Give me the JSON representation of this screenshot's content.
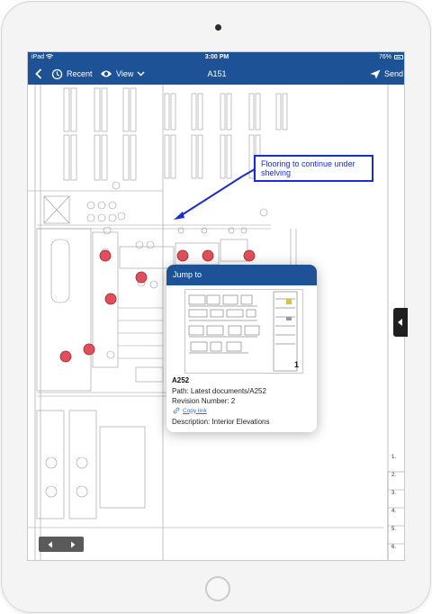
{
  "status": {
    "carrier": "iPad",
    "time": "3:00 PM",
    "battery": "76%"
  },
  "nav": {
    "back_icon": "chevron-left-icon",
    "recent_label": "Recent",
    "view_label": "View",
    "title": "A151",
    "send_label": "Send"
  },
  "callout": {
    "text": "Flooring to continue under shelving"
  },
  "jump_popup": {
    "header": "Jump to",
    "thumbnail_page_number": "1",
    "name": "A252",
    "path": "Path:  Latest documents/A252",
    "revision": "Revision Number: 2",
    "copy_link": "Copy link",
    "description": "Description: Interior Elevations"
  },
  "schedule_numbers": [
    "1.",
    "2.",
    "3.",
    "4.",
    "5.",
    "6."
  ],
  "colors": {
    "brand_blue": "#1d5396",
    "markup_blue": "#1b2bd6",
    "marker_red": "#e0505a",
    "link": "#2a6fd1"
  }
}
